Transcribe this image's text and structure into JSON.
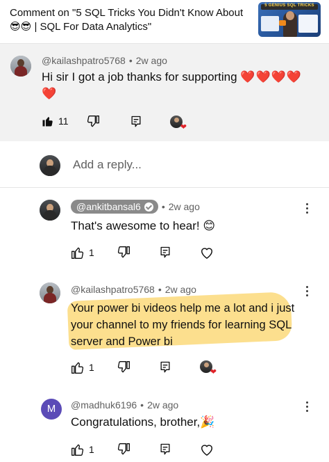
{
  "header": {
    "title": "Comment on \"5 SQL Tricks You Didn't Know About 😎😎 | SQL For Data Analytics\"",
    "thumbnail_caption": "5 GENIUS SQL TRICKS"
  },
  "main_comment": {
    "author": "@kailashpatro5768",
    "time": "2w ago",
    "text": "Hi sir I got a job thanks for supporting",
    "hearts": "❤️❤️❤️❤️❤️",
    "likes": "11"
  },
  "reply_box": {
    "placeholder": "Add a reply..."
  },
  "replies": [
    {
      "author": "@ankitbansal6",
      "time": "2w ago",
      "text": "That's awesome to hear! 😊",
      "likes": "1",
      "verified": true
    },
    {
      "author": "@kailashpatro5768",
      "time": "2w ago",
      "text": "Your power bi videos help me a lot and i just your channel  to my friends for learning SQL server and Power bi",
      "likes": "1"
    },
    {
      "author": "@madhuk6196",
      "time": "2w ago",
      "text": "Congratulations, brother,🎉",
      "likes": "1",
      "avatar_letter": "M"
    }
  ],
  "colors": {
    "heart": "#e0242a",
    "highlight": "#fbd97a",
    "avatar_letter_bg": "#5b4bb7"
  }
}
